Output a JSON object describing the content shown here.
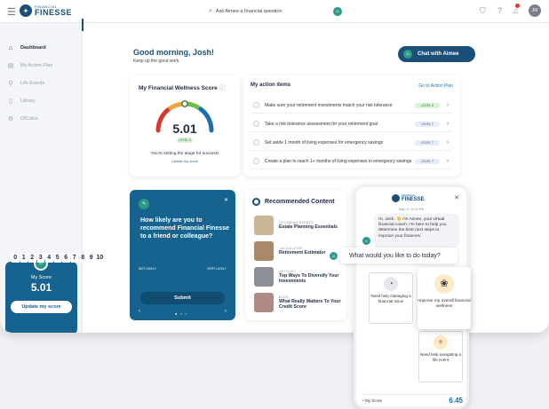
{
  "topbar": {
    "logo_top": "FINANCIAL",
    "logo_main": "FINESSE",
    "search_placeholder": "Ask Aimee a financial question",
    "avatar_initials": "JM"
  },
  "sidebar": {
    "items": [
      {
        "label": "Dashboard",
        "icon": "home-icon"
      },
      {
        "label": "My Action Plan",
        "icon": "plan-icon"
      },
      {
        "label": "Life Events",
        "icon": "pin-icon"
      },
      {
        "label": "Library",
        "icon": "book-icon"
      },
      {
        "label": "OfCalce",
        "icon": "gear-icon"
      }
    ],
    "score_label": "My Score",
    "score_value": "5.01",
    "update_button": "Update my score"
  },
  "greeting": {
    "title": "Good morning, Josh!",
    "subtitle": "Keep up the good work."
  },
  "chat_button": "Chat with Aimee",
  "wellness": {
    "title": "My Financial Wellness Score",
    "info_icon": "ⓘ",
    "score": "5.01",
    "level": "LEVEL 5",
    "score_fraction": 0.5,
    "message": "You're setting the stage for success!",
    "link": "Update my score"
  },
  "actions": {
    "title": "My action items",
    "goto_link": "Go to Action Plan",
    "items": [
      {
        "text": "Make sure your retirement investments match your risk tolerance",
        "level": "LEVEL 5",
        "color": "#d9f3d6",
        "text_color": "#3a7a3a"
      },
      {
        "text": "Take a risk tolerance assessment for your retirement goal",
        "level": "LEVEL 7",
        "color": "#e6ecf8",
        "text_color": "#4a5a8a"
      },
      {
        "text": "Set aside 1 month of living expenses for emergency savings",
        "level": "LEVEL 7",
        "color": "#e6ecf8",
        "text_color": "#4a5a8a"
      },
      {
        "text": "Create a plan to reach 1+ months of living expenses in emergency savings",
        "level": "LEVEL 7",
        "color": "#e6ecf8",
        "text_color": "#4a5a8a"
      }
    ]
  },
  "survey": {
    "question": "How likely are you to recommend Financial Finesse to a friend or colleague?",
    "scale": [
      "0",
      "1",
      "2",
      "3",
      "4",
      "5",
      "6",
      "7",
      "8",
      "9",
      "10"
    ],
    "low_label": "NOT LIKELY",
    "high_label": "VERY LIKELY",
    "submit": "Submit",
    "prev": "‹",
    "next": "›",
    "dots": "● ○ ○"
  },
  "recommended": {
    "title": "Recommended Content",
    "items": [
      {
        "category": "UPCOMING EVENTS",
        "title": "Estate Planning Essentials",
        "thumb": "#c9b79a"
      },
      {
        "category": "CALCULATOR",
        "title": "Retirement Estimator",
        "thumb": "#a88a6a"
      },
      {
        "category": "ARTICLE",
        "title": "Top Ways To Diversify Your Investments",
        "thumb": "#8c8f95"
      },
      {
        "category": "BLOG",
        "title": "What Really Matters To Your Credit Score",
        "thumb": "#b08a84"
      }
    ]
  },
  "phone": {
    "date": "May 12, 10:11 PM",
    "bubble": "Hi, Josh. 👋 I'm Aimee, your virtual financial coach. I'm here to help you determine the best next steps to improve your finances.",
    "option1": "Need help managing a financial issue",
    "option2": "Need help navigating a life event",
    "score_label": "My Score",
    "score_value": "6.45"
  },
  "prompt_question": "What would you like to do today?",
  "highlight_option": "Improve my overall financial wellness"
}
